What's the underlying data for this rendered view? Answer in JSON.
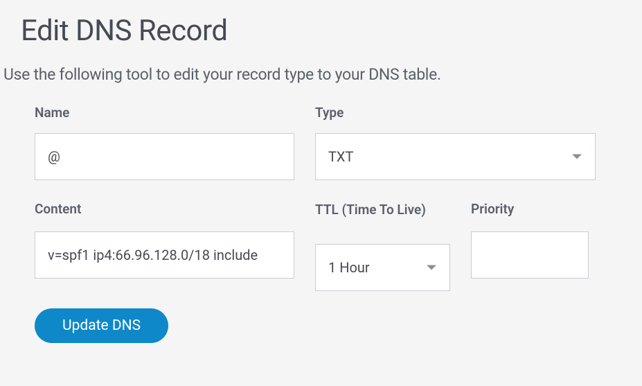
{
  "page": {
    "title": "Edit DNS Record",
    "description": "Use the following tool to edit your record type to your DNS table."
  },
  "form": {
    "name": {
      "label": "Name",
      "value": "@"
    },
    "type": {
      "label": "Type",
      "value": "TXT"
    },
    "content": {
      "label": "Content",
      "value": "v=spf1 ip4:66.96.128.0/18 include"
    },
    "ttl": {
      "label": "TTL (Time To Live)",
      "value": "1 Hour"
    },
    "priority": {
      "label": "Priority",
      "value": ""
    },
    "submit": {
      "label": "Update DNS"
    }
  }
}
